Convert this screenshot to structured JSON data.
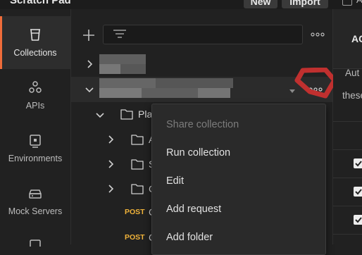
{
  "header": {
    "title": "Scratch Pad",
    "new_label": "New",
    "import_label": "Import",
    "checkbox_label": "A"
  },
  "rail": {
    "items": [
      {
        "label": "Collections",
        "icon": "trash-can-shaped-collections-icon",
        "active": true
      },
      {
        "label": "APIs",
        "icon": "apis-icon"
      },
      {
        "label": "Environments",
        "icon": "environments-icon"
      },
      {
        "label": "Mock Servers",
        "icon": "mock-server-icon"
      }
    ]
  },
  "tree": {
    "folder_pla": "Pla",
    "sub1": "A",
    "sub2": "S",
    "sub3": "C",
    "req1_method": "POST",
    "req1_name": "C",
    "req2_method": "POST",
    "req2_name": "C"
  },
  "context_menu": {
    "items": [
      {
        "label": "Share collection",
        "disabled": true
      },
      {
        "label": "Run collection"
      },
      {
        "label": "Edit"
      },
      {
        "label": "Add request"
      },
      {
        "label": "Add folder"
      }
    ]
  },
  "right_pane": {
    "tab_title": "AC",
    "auth_label": "Aut",
    "these_label": "these"
  },
  "colors": {
    "accent": "#ef6c3a",
    "post": "#f0b33a",
    "highlight": "#c0302f"
  }
}
